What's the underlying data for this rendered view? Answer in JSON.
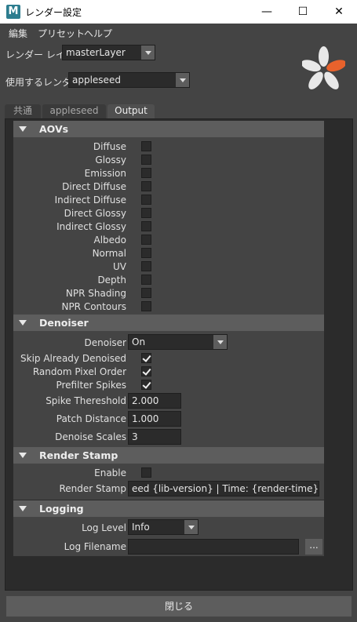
{
  "window": {
    "title": "レンダー設定",
    "app_icon_letter": "M",
    "minimize": "—",
    "maximize": "☐",
    "close": "✕"
  },
  "menu": [
    "編集",
    "プリセット",
    "ヘルプ"
  ],
  "render_layer": {
    "label": "レンダー レイヤ",
    "value": "masterLayer"
  },
  "renderer": {
    "label": "使用するレンダラ",
    "value": "appleseed"
  },
  "tabs": [
    {
      "label": "共通",
      "active": false
    },
    {
      "label": "appleseed",
      "active": false
    },
    {
      "label": "Output",
      "active": true
    }
  ],
  "sections": {
    "aovs": {
      "title": "AOVs",
      "items": [
        {
          "label": "Diffuse",
          "checked": false
        },
        {
          "label": "Glossy",
          "checked": false
        },
        {
          "label": "Emission",
          "checked": false
        },
        {
          "label": "Direct Diffuse",
          "checked": false
        },
        {
          "label": "Indirect Diffuse",
          "checked": false
        },
        {
          "label": "Direct Glossy",
          "checked": false
        },
        {
          "label": "Indirect Glossy",
          "checked": false
        },
        {
          "label": "Albedo",
          "checked": false
        },
        {
          "label": "Normal",
          "checked": false
        },
        {
          "label": "UV",
          "checked": false
        },
        {
          "label": "Depth",
          "checked": false
        },
        {
          "label": "NPR Shading",
          "checked": false
        },
        {
          "label": "NPR Contours",
          "checked": false
        }
      ]
    },
    "denoiser": {
      "title": "Denoiser",
      "denoiser_label": "Denoiser",
      "denoiser_value": "On",
      "skip_label": "Skip Already Denoised",
      "skip_checked": true,
      "random_label": "Random Pixel Order",
      "random_checked": true,
      "prefilter_label": "Prefilter Spikes",
      "prefilter_checked": true,
      "spike_label": "Spike Thereshold",
      "spike_value": "2.000",
      "patch_label": "Patch Distance",
      "patch_value": "1.000",
      "scales_label": "Denoise Scales",
      "scales_value": "3"
    },
    "render_stamp": {
      "title": "Render Stamp",
      "enable_label": "Enable",
      "enable_checked": false,
      "stamp_label": "Render Stamp",
      "stamp_value": "eed {lib-version} | Time: {render-time}"
    },
    "logging": {
      "title": "Logging",
      "level_label": "Log Level",
      "level_value": "Info",
      "filename_label": "Log Filename",
      "filename_value": "",
      "browse_label": "..."
    }
  },
  "footer": {
    "close_label": "閉じる"
  },
  "colors": {
    "accent_orange": "#e8622c",
    "logo_white": "#e8e8e8",
    "panel_bg": "#444444",
    "header_bg": "#5d5d5d"
  }
}
